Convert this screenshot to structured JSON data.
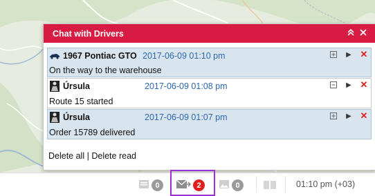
{
  "chat": {
    "title": "Chat with Drivers",
    "collapse_icon": "double-chevron-up-icon",
    "close_icon": "close-icon",
    "messages": [
      {
        "sender": "1967 Pontiac GTO",
        "sender_icon": "car-icon",
        "time": "2017-06-09 01:10 pm",
        "text": "On the way to the warehouse",
        "expand_icon": "expand-icon",
        "state": "unread"
      },
      {
        "sender": "Úrsula",
        "sender_icon": "driver-icon",
        "time": "2017-06-09 01:08 pm",
        "text": "Route 15 started",
        "expand_icon": "collapse-icon",
        "state": "read"
      },
      {
        "sender": "Úrsula",
        "sender_icon": "driver-icon",
        "time": "2017-06-09 01:07 pm",
        "text": "Order 15789 delivered",
        "expand_icon": "expand-icon",
        "state": "unread"
      }
    ],
    "footer": {
      "delete_all": "Delete all",
      "separator": "|",
      "delete_read": "Delete read"
    }
  },
  "statusbar": {
    "notifications_count": "0",
    "messages_count": "2",
    "images_count": "0",
    "time": "01:10 pm (+03)"
  },
  "colors": {
    "header": "#d81b43",
    "unread_bg": "#d8e5ef",
    "time_text": "#2d67b0",
    "badge_red": "#e0201f",
    "badge_grey": "#9a9a9a",
    "highlight": "#9b30d9"
  }
}
